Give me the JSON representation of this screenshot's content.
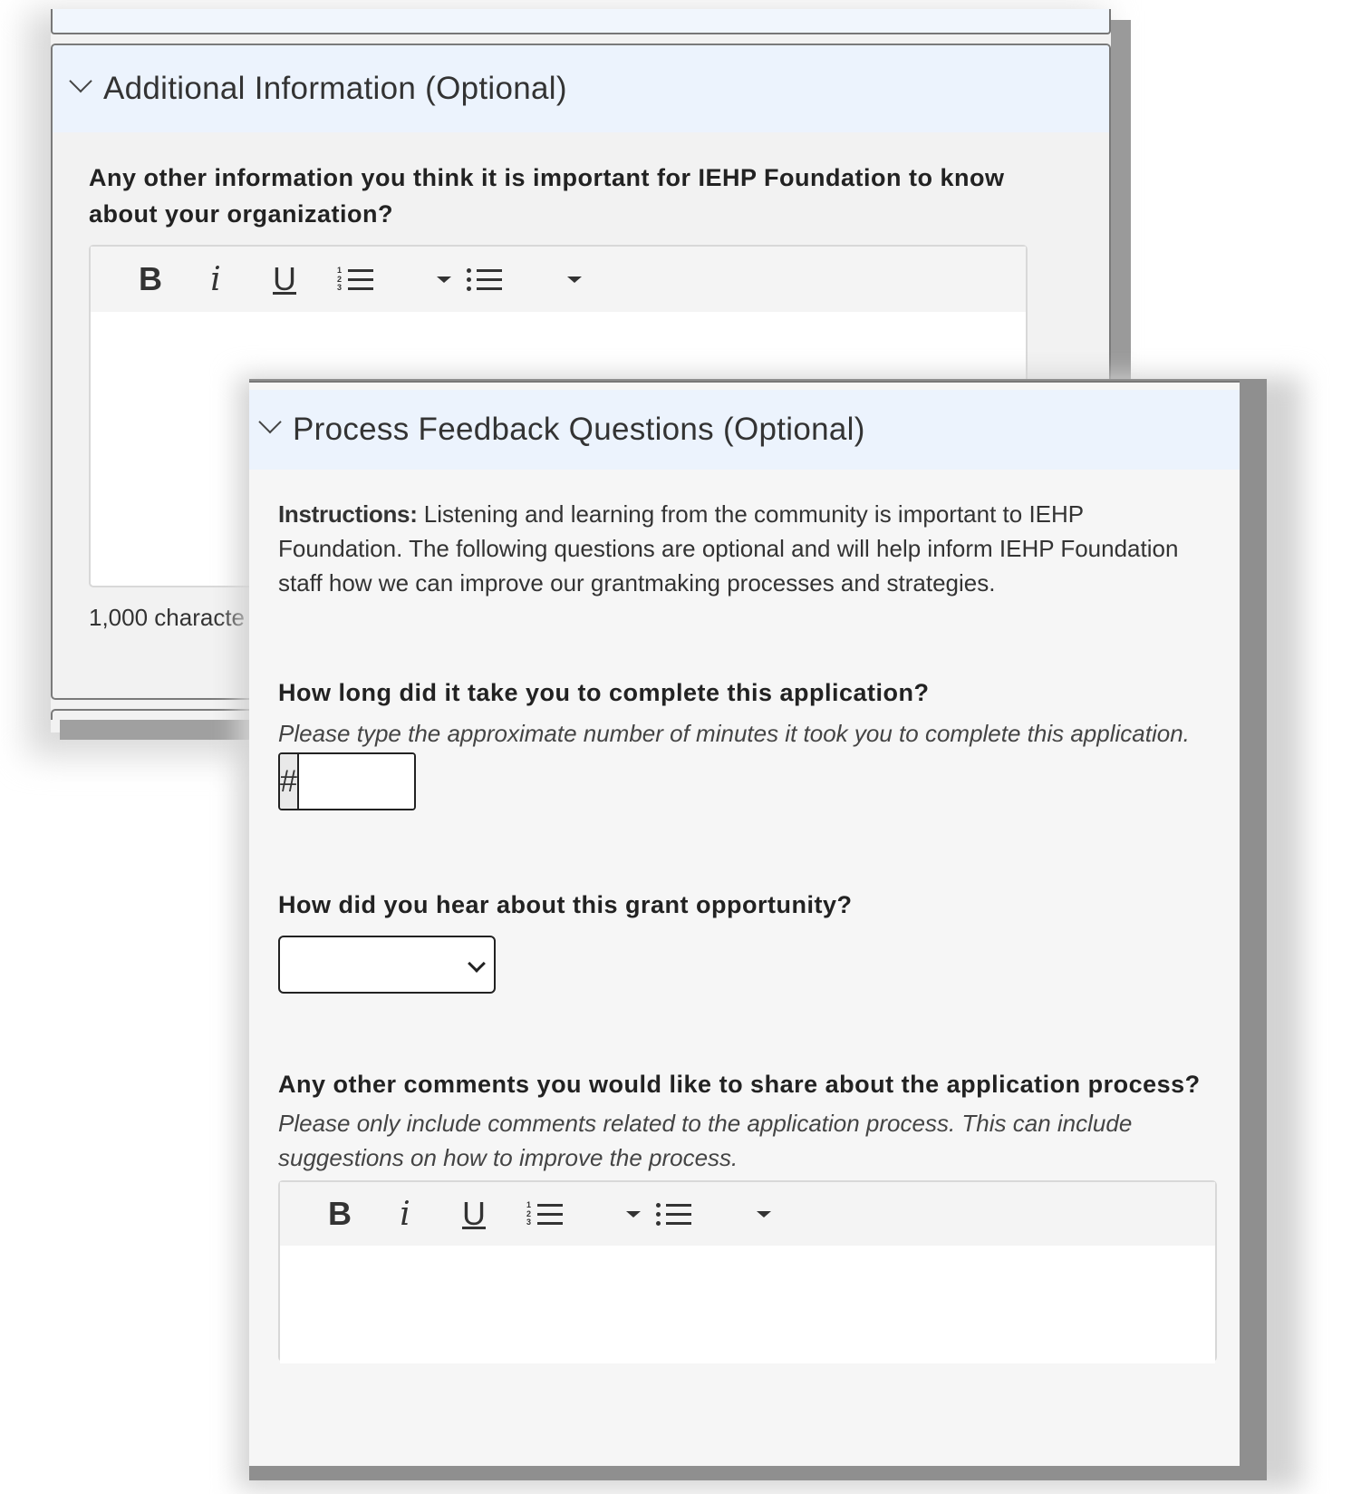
{
  "additional_info": {
    "title": "Additional Information (Optional)",
    "question": "Any other information you think it is important for IEHP Foundation to know about your organization?",
    "char_count": "1,000 characte"
  },
  "toolbar": {
    "bold": "B",
    "italic": "i",
    "underline": "U",
    "numbered_list_icon": "numbered-list-icon",
    "bulleted_list_icon": "bulleted-list-icon",
    "dropdown_icon": "caret-down-icon"
  },
  "process_feedback": {
    "title": "Process Feedback Questions (Optional)",
    "instructions_label": "Instructions:",
    "instructions_text": " Listening and learning from the community is important to IEHP Foundation. The following questions are optional and will help inform IEHP Foundation staff how we can improve our grantmaking processes and strategies.",
    "q1": {
      "label": "How long did it take you to complete this application?",
      "hint": "Please type the approximate number of minutes it took you to complete this application.",
      "prefix": "#",
      "value": ""
    },
    "q2": {
      "label": "How did you hear about this grant opportunity?",
      "selected": ""
    },
    "q3": {
      "label": "Any other comments you would like to share about the application process?",
      "hint": "Please only include comments related to the application process. This can include suggestions on how to improve the process."
    }
  }
}
